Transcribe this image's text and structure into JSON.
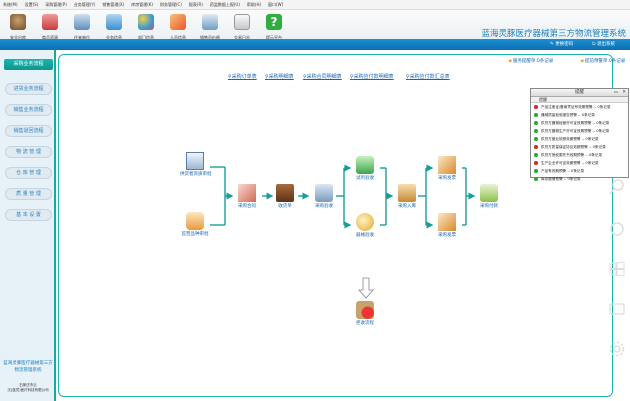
{
  "menubar": [
    "系统(M)",
    "设置(S)",
    "采购管理(P)",
    "业务管理(Y)",
    "销售管理(X)",
    "库房管理(K)",
    "财务管理(C)",
    "报表(R)",
    "药监数据上报(U)",
    "帮助(H)",
    "窗口(W)"
  ],
  "toolbar": [
    "安全出库",
    "商品资源",
    "往来单位",
    "业务信息",
    "部门信息",
    "人员信息",
    "销售员价格",
    "交易日志",
    "提示平台"
  ],
  "app_title": "蓝海灵豚医疗器械第三方物流管理系统",
  "header_links": {
    "change_password": "更换密码",
    "logout": "退出系统"
  },
  "sidebar": {
    "section": "采购业务流程",
    "items": [
      "进货业务流程",
      "销售业务流程",
      "销售退回流程",
      "物 流 管 理",
      "仓 库 管 理",
      "质 量 管 理",
      "基 本 设 置"
    ],
    "footer_title": "蓝海灵豚医疗器械第三方物流管理系统",
    "footer_company": "石家庄市云\n汉(蓝灵)医疗科技有限公司"
  },
  "top_links": [
    "采购订单表",
    "采购明细表",
    "采购合同明细表",
    "采购应付款明细表",
    "采购应付款汇总表"
  ],
  "right_links": [
    "服务提醒单:0条记录",
    "提前预警单:0条记录"
  ],
  "nodes": {
    "supplier": "供货者资质审批",
    "product": "首营品种审批",
    "contract": "采购合同",
    "receive": "收货单",
    "check": "采购验收",
    "inspect": "试剂验收",
    "device_check": "器械验收",
    "storage": "采购入库",
    "invoice": "采购发票",
    "invoice2": "采购发票",
    "payment": "采购付款",
    "reject": "拒收流程"
  },
  "panel": {
    "title": "提醒",
    "column": "提醒",
    "rows": [
      {
        "text": "产品注册证/备案凭证号效期预警 -- 0条记录",
        "color": "#d22"
      },
      {
        "text": "器械质量检验报告预警 -- 0条记录",
        "color": "#2a3"
      },
      {
        "text": "供货方器械经营许可证效期预警 -- 0条记录",
        "color": "#2a3"
      },
      {
        "text": "供货方器械生产许可证效期预警 -- 0条记录",
        "color": "#2a3"
      },
      {
        "text": "供货方营业执照效期预警 -- 0条记录",
        "color": "#2a3"
      },
      {
        "text": "供货方质量保证协议效期预警 -- 0条记录",
        "color": "#d22"
      },
      {
        "text": "供货方授权委托书效期预警 -- 0条记录",
        "color": "#2a3"
      },
      {
        "text": "生产企业许可证效期预警 -- 0条记录",
        "color": "#d22"
      },
      {
        "text": "产品有效期预警 -- 0条记录",
        "color": "#2a3"
      },
      {
        "text": "库存超储预警 -- 0条记录",
        "color": "#2a3"
      }
    ]
  }
}
